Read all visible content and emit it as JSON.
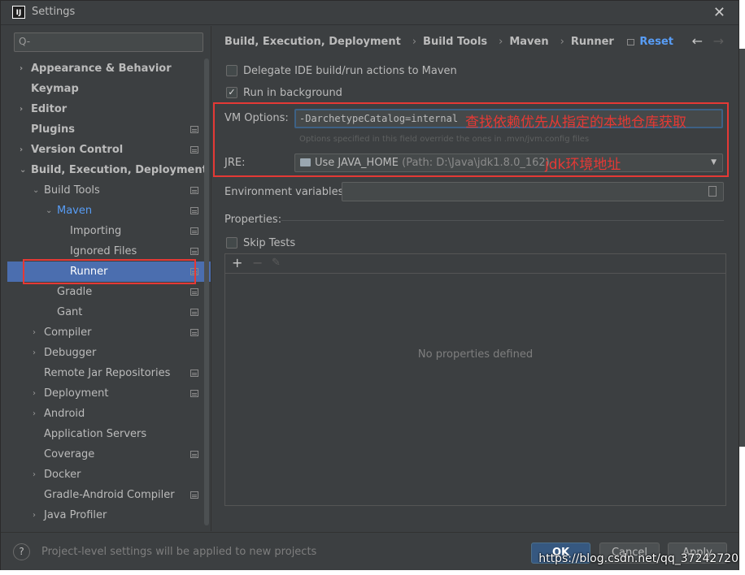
{
  "window": {
    "title": "Settings",
    "app_icon": "IJ"
  },
  "search": {
    "placeholder": "Q-"
  },
  "tree": [
    {
      "label": "Appearance & Behavior",
      "arrow": "›",
      "bold": true
    },
    {
      "label": "Keymap",
      "arrow": "",
      "bold": true
    },
    {
      "label": "Editor",
      "arrow": "›",
      "bold": true
    },
    {
      "label": "Plugins",
      "arrow": "",
      "bold": true,
      "proj": true
    },
    {
      "label": "Version Control",
      "arrow": "›",
      "bold": true,
      "proj": true
    },
    {
      "label": "Build, Execution, Deployment",
      "arrow": "⌄",
      "bold": true
    },
    {
      "label": "Build Tools",
      "arrow": "⌄",
      "proj": true
    },
    {
      "label": "Maven",
      "arrow": "⌄",
      "proj": true,
      "blue": true
    },
    {
      "label": "Importing",
      "arrow": "",
      "proj": true
    },
    {
      "label": "Ignored Files",
      "arrow": "",
      "proj": true
    },
    {
      "label": "Runner",
      "arrow": "",
      "proj": true,
      "selected": true
    },
    {
      "label": "Gradle",
      "arrow": "",
      "proj": true
    },
    {
      "label": "Gant",
      "arrow": "",
      "proj": true
    },
    {
      "label": "Compiler",
      "arrow": "›",
      "proj": true
    },
    {
      "label": "Debugger",
      "arrow": "›"
    },
    {
      "label": "Remote Jar Repositories",
      "arrow": "",
      "proj": true
    },
    {
      "label": "Deployment",
      "arrow": "›",
      "proj": true
    },
    {
      "label": "Android",
      "arrow": "›"
    },
    {
      "label": "Application Servers",
      "arrow": ""
    },
    {
      "label": "Coverage",
      "arrow": "",
      "proj": true
    },
    {
      "label": "Docker",
      "arrow": "›"
    },
    {
      "label": "Gradle-Android Compiler",
      "arrow": "",
      "proj": true
    },
    {
      "label": "Java Profiler",
      "arrow": "›"
    }
  ],
  "breadcrumb": [
    "Build, Execution, Deployment",
    "Build Tools",
    "Maven",
    "Runner"
  ],
  "header": {
    "reset": "Reset"
  },
  "options": {
    "delegate_label": "Delegate IDE build/run actions to Maven",
    "delegate_checked": false,
    "background_label": "Run in background",
    "background_checked": true,
    "vm_label": "VM Options:",
    "vm_value": "-DarchetypeCatalog=internal",
    "vm_hint": "Options specified in this field override the ones in .mvn/jvm.config files",
    "vm_annotation": "查找依赖优先从指定的本地仓库获取",
    "jre_label": "JRE:",
    "jre_value": "Use JAVA_HOME",
    "jre_path": "(Path: D:\\Java\\jdk1.8.0_162)",
    "jre_annotation": "jdk环境地址",
    "env_label": "Environment variables:",
    "properties_label": "Properties:",
    "skip_tests_label": "Skip Tests",
    "skip_tests_checked": false,
    "empty_properties": "No properties defined"
  },
  "footer": {
    "help": "?",
    "text": "Project-level settings will be applied to new projects",
    "ok": "OK",
    "cancel": "Cancel",
    "apply": "Apply"
  },
  "watermark": "https://blog.csdn.net/qq_37242720",
  "colors": {
    "accent": "#589df6",
    "selected": "#4b6eaf",
    "annotation": "#e53935",
    "background": "#3c3f41"
  }
}
